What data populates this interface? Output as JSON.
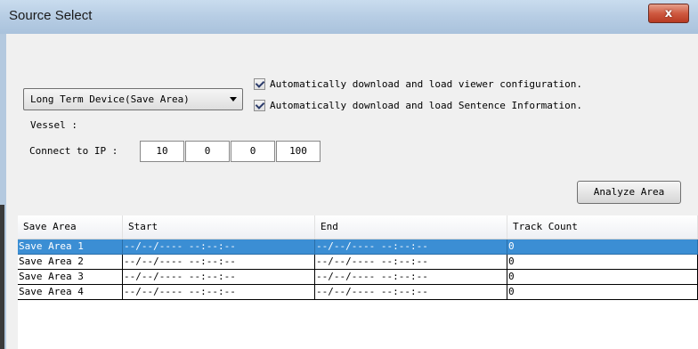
{
  "window": {
    "title": "Source Select",
    "close_label": "x"
  },
  "source_combo": {
    "selected": "Long Term Device(Save Area)"
  },
  "options": {
    "auto_viewer_config": {
      "label": "Automatically download and load viewer configuration.",
      "checked": true
    },
    "auto_sentence_info": {
      "label": "Automatically download and load Sentence Information.",
      "checked": true
    }
  },
  "vessel": {
    "label": "Vessel :"
  },
  "connect": {
    "label": "Connect to IP :",
    "ip": [
      "10",
      "0",
      "0",
      "100"
    ]
  },
  "analyze_button": {
    "label": "Analyze Area"
  },
  "table": {
    "columns": [
      "Save Area",
      "Start",
      "End",
      "Track Count"
    ],
    "rows": [
      [
        "Save Area 1",
        "--/--/---- --:--:--",
        "--/--/---- --:--:--",
        "0"
      ],
      [
        "Save Area 2",
        "--/--/---- --:--:--",
        "--/--/---- --:--:--",
        "0"
      ],
      [
        "Save Area 3",
        "--/--/---- --:--:--",
        "--/--/---- --:--:--",
        "0"
      ],
      [
        "Save Area 4",
        "--/--/---- --:--:--",
        "--/--/---- --:--:--",
        "0"
      ]
    ],
    "selected_row": 0
  },
  "colors": {
    "selection": "#3b8ed4",
    "title_bar": "#b7cde4",
    "close_button": "#cf5a41"
  }
}
